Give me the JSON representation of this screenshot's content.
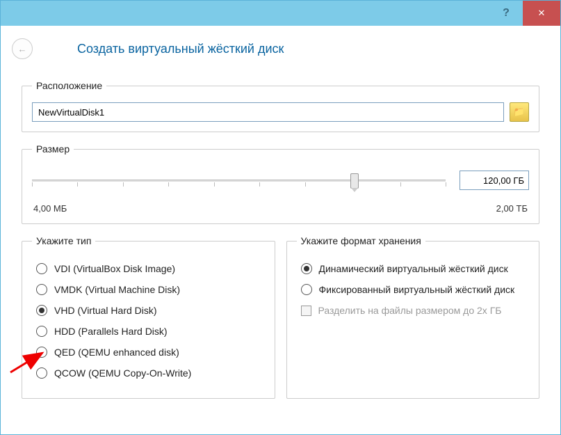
{
  "titlebar": {
    "help_glyph": "?",
    "close_glyph": "✕"
  },
  "header": {
    "back_glyph": "←",
    "title": "Создать виртуальный жёсткий диск"
  },
  "location": {
    "legend": "Расположение",
    "value": "NewVirtualDisk1",
    "browse_icon": "📁"
  },
  "size": {
    "legend": "Размер",
    "value": "120,00 ГБ",
    "min_label": "4,00 МБ",
    "max_label": "2,00 ТБ"
  },
  "type": {
    "legend": "Укажите тип",
    "options": [
      {
        "label": "VDI (VirtualBox Disk Image)",
        "checked": false
      },
      {
        "label": "VMDK (Virtual Machine Disk)",
        "checked": false
      },
      {
        "label": "VHD (Virtual Hard Disk)",
        "checked": true
      },
      {
        "label": "HDD (Parallels Hard Disk)",
        "checked": false
      },
      {
        "label": "QED (QEMU enhanced disk)",
        "checked": false
      },
      {
        "label": "QCOW (QEMU Copy-On-Write)",
        "checked": false
      }
    ]
  },
  "storage": {
    "legend": "Укажите формат хранения",
    "options": [
      {
        "label": "Динамический виртуальный жёсткий диск",
        "checked": true
      },
      {
        "label": "Фиксированный виртуальный жёсткий диск",
        "checked": false
      }
    ],
    "split_label": "Разделить на файлы размером до 2х ГБ",
    "split_enabled": false
  }
}
